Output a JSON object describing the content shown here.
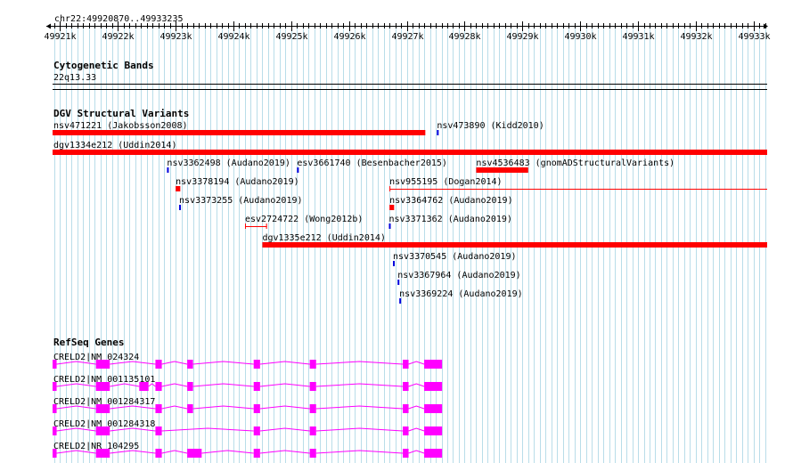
{
  "region": {
    "label": "chr22:49920870..49933235",
    "start": 49920870,
    "end": 49933235
  },
  "ruler": {
    "ticks": [
      {
        "pos": 49921000,
        "label": "49921k"
      },
      {
        "pos": 49922000,
        "label": "49922k"
      },
      {
        "pos": 49923000,
        "label": "49923k"
      },
      {
        "pos": 49924000,
        "label": "49924k"
      },
      {
        "pos": 49925000,
        "label": "49925k"
      },
      {
        "pos": 49926000,
        "label": "49926k"
      },
      {
        "pos": 49927000,
        "label": "49927k"
      },
      {
        "pos": 49928000,
        "label": "49928k"
      },
      {
        "pos": 49929000,
        "label": "49929k"
      },
      {
        "pos": 49930000,
        "label": "49930k"
      },
      {
        "pos": 49931000,
        "label": "49931k"
      },
      {
        "pos": 49932000,
        "label": "49932k"
      },
      {
        "pos": 49933000,
        "label": "49933k"
      }
    ]
  },
  "tracks": {
    "cytoband": {
      "title": "Cytogenetic Bands",
      "band": "22q13.33"
    },
    "dgv": {
      "title": "DGV Structural Variants",
      "features": [
        {
          "name": "nsv471221 (Jakobsson2008)",
          "start": 49920870,
          "end": 49927320,
          "style": "bar"
        },
        {
          "name": "nsv473890 (Kidd2010)",
          "start": 49927520,
          "end": 49927560,
          "style": "tick-blue"
        },
        {
          "name": "dgv1334e212 (Uddin2014)",
          "start": 49920870,
          "end": 49933235,
          "style": "bar"
        },
        {
          "name": "nsv3362498 (Audano2019)",
          "start": 49922850,
          "end": 49922890,
          "style": "tick-blue"
        },
        {
          "name": "esv3661740 (Besenbacher2015)",
          "start": 49925100,
          "end": 49925140,
          "style": "tick-blue"
        },
        {
          "name": "nsv4536483 (gnomADStructuralVariants)",
          "start": 49928200,
          "end": 49929100,
          "style": "bar"
        },
        {
          "name": "nsv3378194 (Audano2019)",
          "start": 49923000,
          "end": 49923080,
          "style": "small-red"
        },
        {
          "name": "nsv955195 (Dogan2014)",
          "start": 49926700,
          "end": 49933235,
          "style": "line-red"
        },
        {
          "name": "nsv3373255 (Audano2019)",
          "start": 49923060,
          "end": 49923100,
          "style": "tick-blue"
        },
        {
          "name": "nsv3364762 (Audano2019)",
          "start": 49926700,
          "end": 49926780,
          "style": "small-red"
        },
        {
          "name": "esv2724722 (Wong2012b)",
          "start": 49924200,
          "end": 49924580,
          "style": "bracket-red"
        },
        {
          "name": "nsv3371362 (Audano2019)",
          "start": 49926690,
          "end": 49926730,
          "style": "tick-blue"
        },
        {
          "name": "dgv1335e212 (Uddin2014)",
          "start": 49924500,
          "end": 49933235,
          "style": "bar"
        },
        {
          "name": "nsv3370545 (Audano2019)",
          "start": 49926760,
          "end": 49926800,
          "style": "tick-blue"
        },
        {
          "name": "nsv3367964 (Audano2019)",
          "start": 49926840,
          "end": 49926880,
          "style": "tick-blue"
        },
        {
          "name": "nsv3369224 (Audano2019)",
          "start": 49926870,
          "end": 49926910,
          "style": "tick-blue"
        }
      ]
    },
    "refseq": {
      "title": "RefSeq Genes",
      "transcripts": [
        {
          "name": "CRELD2|NM_024324",
          "start": 49920870,
          "end": 49927610,
          "exons": [
            [
              49920870,
              49920940
            ],
            [
              49921620,
              49921860
            ],
            [
              49922650,
              49922760
            ],
            [
              49923200,
              49923300
            ],
            [
              49924350,
              49924460
            ],
            [
              49925320,
              49925430
            ],
            [
              49926930,
              49927030
            ],
            [
              49927300,
              49927610
            ]
          ]
        },
        {
          "name": "CRELD2|NM_001135101",
          "start": 49920870,
          "end": 49927610,
          "exons": [
            [
              49920870,
              49920940
            ],
            [
              49921620,
              49921860
            ],
            [
              49922370,
              49922530
            ],
            [
              49922650,
              49922760
            ],
            [
              49923200,
              49923300
            ],
            [
              49924350,
              49924460
            ],
            [
              49925320,
              49925430
            ],
            [
              49926930,
              49927030
            ],
            [
              49927300,
              49927610
            ]
          ]
        },
        {
          "name": "CRELD2|NM_001284317",
          "start": 49920870,
          "end": 49927610,
          "exons": [
            [
              49920870,
              49920940
            ],
            [
              49921620,
              49921860
            ],
            [
              49922650,
              49922760
            ],
            [
              49923200,
              49923300
            ],
            [
              49924350,
              49924460
            ],
            [
              49925320,
              49925430
            ],
            [
              49926930,
              49927030
            ],
            [
              49927300,
              49927610
            ]
          ]
        },
        {
          "name": "CRELD2|NM_001284318",
          "start": 49920870,
          "end": 49927610,
          "exons": [
            [
              49920870,
              49920940
            ],
            [
              49921620,
              49921860
            ],
            [
              49922650,
              49922760
            ],
            [
              49924350,
              49924460
            ],
            [
              49925320,
              49925430
            ],
            [
              49926930,
              49927030
            ],
            [
              49927300,
              49927610
            ]
          ]
        },
        {
          "name": "CRELD2|NR_104295",
          "start": 49920870,
          "end": 49927610,
          "exons": [
            [
              49920870,
              49920940
            ],
            [
              49921620,
              49921860
            ],
            [
              49922650,
              49922760
            ],
            [
              49923200,
              49923450
            ],
            [
              49924350,
              49924460
            ],
            [
              49925320,
              49925430
            ],
            [
              49926930,
              49927030
            ],
            [
              49927300,
              49927610
            ]
          ]
        }
      ]
    }
  },
  "colors": {
    "variant_red": "#ff0000",
    "variant_blue": "#0000dd",
    "gene_magenta": "#ff00ff",
    "grid_line": "#b9dde9",
    "axis_black": "#000000"
  }
}
